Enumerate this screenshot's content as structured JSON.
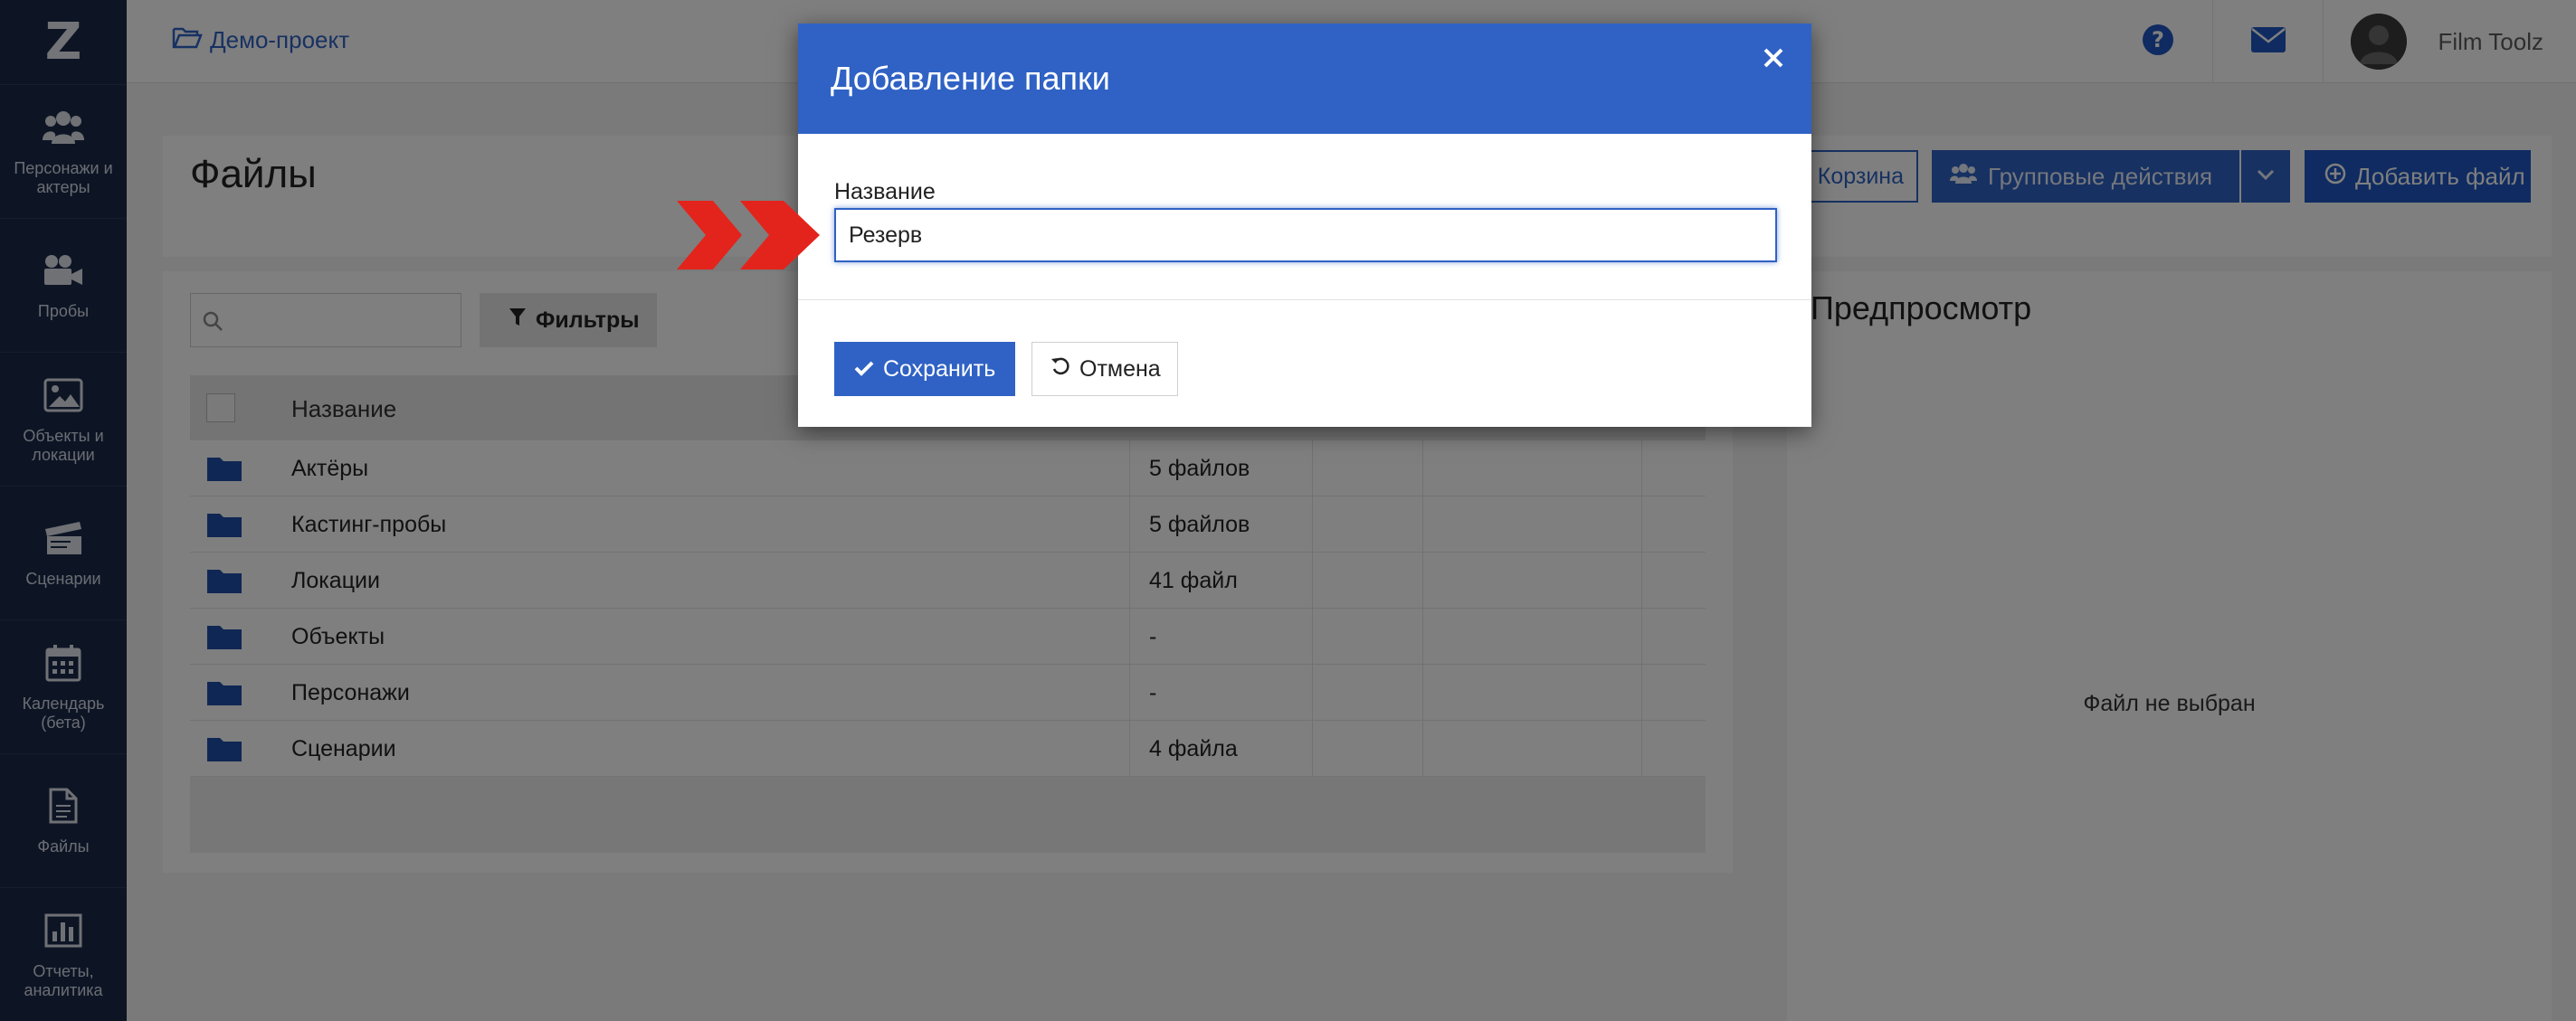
{
  "app": {
    "logo_text": "Z",
    "accent_color": "#2f62c4",
    "sidebar_color": "#1b2a4a"
  },
  "sidebar": {
    "items": [
      {
        "label": "Персонажи и актеры",
        "icon": "users-icon"
      },
      {
        "label": "Пробы",
        "icon": "video-camera-icon"
      },
      {
        "label": "Объекты и локации",
        "icon": "image-icon"
      },
      {
        "label": "Сценарии",
        "icon": "clapperboard-icon"
      },
      {
        "label": "Календарь (бета)",
        "icon": "calendar-icon"
      },
      {
        "label": "Файлы",
        "icon": "file-icon"
      },
      {
        "label": "Отчеты, аналитика",
        "icon": "bar-chart-icon"
      }
    ]
  },
  "topbar": {
    "project": "Демо-проект",
    "user_name": "Film Toolz"
  },
  "page": {
    "title": "Файлы",
    "trash_label": "Корзина",
    "group_actions_label": "Групповые действия",
    "add_file_label": "Добавить файл",
    "filter_label": "Фильтры",
    "search_placeholder": ""
  },
  "table": {
    "header_name": "Название",
    "rows": [
      {
        "name": "Актёры",
        "count": "5 файлов"
      },
      {
        "name": "Кастинг-пробы",
        "count": "5 файлов"
      },
      {
        "name": "Локации",
        "count": "41 файл"
      },
      {
        "name": "Объекты",
        "count": "-"
      },
      {
        "name": "Персонажи",
        "count": "-"
      },
      {
        "name": "Сценарии",
        "count": "4 файла"
      }
    ]
  },
  "preview": {
    "title": "Предпросмотр",
    "empty_text": "Файл не выбран"
  },
  "modal": {
    "title": "Добавление папки",
    "field_label": "Название",
    "field_value": "Резерв",
    "save_label": "Сохранить",
    "cancel_label": "Отмена"
  }
}
